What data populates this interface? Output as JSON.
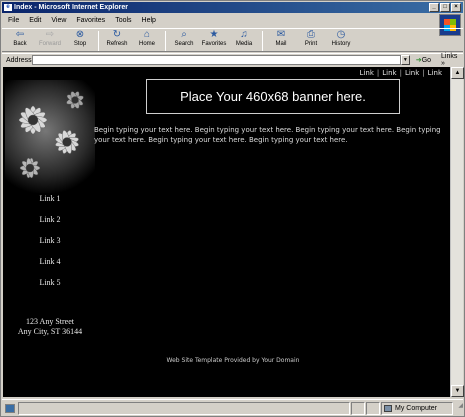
{
  "window": {
    "title": "Index - Microsoft Internet Explorer"
  },
  "menu": [
    "File",
    "Edit",
    "View",
    "Favorites",
    "Tools",
    "Help"
  ],
  "toolbar": [
    {
      "label": "Back",
      "icon": "back-arrow-icon",
      "glyph": "⇦",
      "enabled": true
    },
    {
      "label": "Forward",
      "icon": "forward-arrow-icon",
      "glyph": "⇨",
      "enabled": false
    },
    {
      "label": "Stop",
      "icon": "stop-icon",
      "glyph": "⊗",
      "enabled": true
    },
    {
      "label": "Refresh",
      "icon": "refresh-icon",
      "glyph": "↻",
      "enabled": true
    },
    {
      "label": "Home",
      "icon": "home-icon",
      "glyph": "⌂",
      "enabled": true
    },
    {
      "label": "Search",
      "icon": "search-icon",
      "glyph": "⌕",
      "enabled": true
    },
    {
      "label": "Favorites",
      "icon": "favorites-icon",
      "glyph": "★",
      "enabled": true
    },
    {
      "label": "Media",
      "icon": "media-icon",
      "glyph": "♫",
      "enabled": true
    },
    {
      "label": "Mail",
      "icon": "mail-icon",
      "glyph": "✉",
      "enabled": true
    },
    {
      "label": "Print",
      "icon": "print-icon",
      "glyph": "⎙",
      "enabled": true
    },
    {
      "label": "History",
      "icon": "history-icon",
      "glyph": "◷",
      "enabled": true
    }
  ],
  "address": {
    "label": "Address",
    "value": "",
    "go": "Go",
    "links": "Links"
  },
  "page": {
    "toplinks": [
      "Link",
      "Link",
      "Link",
      "Link"
    ],
    "banner": "Place Your 460x68 banner here.",
    "body": "Begin typing your text here. Begin typing your text here. Begin typing your text here. Begin typing your text here. Begin typing your text here. Begin typing your text here.",
    "nav": [
      "Link 1",
      "Link 2",
      "Link 3",
      "Link 4",
      "Link 5"
    ],
    "address_line1": "123 Any Street",
    "address_line2": "Any City, ST 36144",
    "footer": "Web Site Template Provided by Your Domain"
  },
  "status": {
    "zone": "My Computer"
  }
}
